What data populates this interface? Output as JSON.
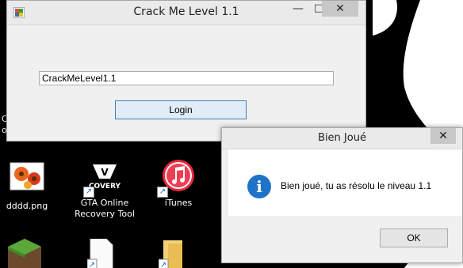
{
  "main_window": {
    "title": "Crack Me Level 1.1",
    "minimize_glyph": "—",
    "maximize_glyph": "□",
    "close_glyph": "✕",
    "textbox_value": "CrackMeLevel1.1",
    "login_label": "Login"
  },
  "dialog": {
    "title": "Bien Joué",
    "close_glyph": "✕",
    "message": "Bien joué, tu as résolu le niveau 1.1",
    "info_glyph": "i",
    "ok_label": "OK"
  },
  "desktop": {
    "icons": [
      {
        "name": "dddd-png",
        "label": "dddd.png",
        "icon": "image-file-icon"
      },
      {
        "name": "gta-online-recovery-tool",
        "label": "GTA Online Recovery Tool",
        "icon": "gta-icon"
      },
      {
        "name": "itunes",
        "label": "iTunes",
        "icon": "itunes-icon"
      }
    ],
    "partial_labels": [
      "C",
      "o"
    ]
  },
  "colors": {
    "desktop_bg": "#000000",
    "window_bg": "#f0f0f0",
    "accent_blue": "#1e73c8",
    "close_btn_bg": "#c7c7c7"
  }
}
